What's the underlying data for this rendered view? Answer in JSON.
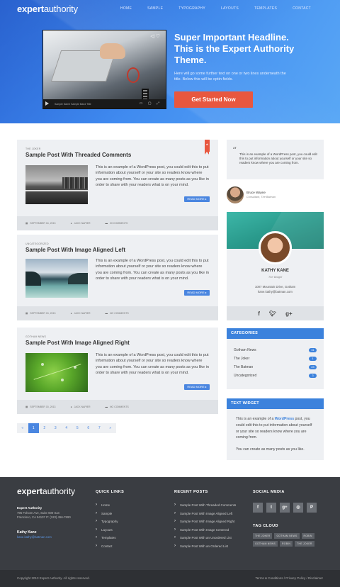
{
  "brand": {
    "bold": "expert",
    "light": "authority"
  },
  "nav": [
    "HOME",
    "SAMPLE",
    "TYPOGRAPHY",
    "LAYOUTS",
    "TEMPLATES",
    "CONTACT"
  ],
  "hero": {
    "headline": "Super Important Headline. This is the Expert Authority Theme.",
    "subtext": "Here will go some further text on one or two lines underneath the title. Below this will be optin fields.",
    "cta": "Get Started Now",
    "video_title": "Sample Name  Sample Band Title",
    "video_time": "0:00"
  },
  "posts": [
    {
      "category": "THE JOKER",
      "title": "Sample Post With Threaded Comments",
      "excerpt": "This is an example of a WordPress post, you could edit this to put information about yourself or your site so readers know where you are coming from. You can create as many posts as you like in order to share with your readers what is on your mind.",
      "read_more": "READ MORE ▸",
      "date": "SEPTEMBER 16, 2013",
      "author": "JACK NAPIER",
      "comments": "30 COMMENTS"
    },
    {
      "category": "UNCATEGORIZED",
      "title": "Sample Post With Image Aligned Left",
      "excerpt": "This is an example of a WordPress post, you could edit this to put information about yourself or your site so readers know where you are coming from. You can create as many posts as you like in order to share with your readers what is on your mind.",
      "read_more": "READ MORE ▸",
      "date": "SEPTEMBER 15, 2013",
      "author": "JACK NAPIER",
      "comments": "NO COMMENTS"
    },
    {
      "category": "GOTHAM NEWS",
      "title": "Sample Post With Image Aligned Right",
      "excerpt": "This is an example of a WordPress post, you could edit this to put information about yourself or your site so readers know where you are coming from. You can create as many posts as you like in order to share with your readers what is on your mind.",
      "read_more": "READ MORE ▸",
      "date": "SEPTEMBER 15, 2013",
      "author": "JACK NAPIER",
      "comments": "NO COMMENTS"
    }
  ],
  "pagination": [
    "«",
    "1",
    "2",
    "3",
    "4",
    "5",
    "6",
    "7",
    "»"
  ],
  "sidebar": {
    "quote": "This is an example of a WordPress post, you could edit this to put information about yourself or your site so readers know where you are coming from.",
    "quote_author": "Bruce Wayne",
    "quote_role": "Consultant, The Batman",
    "profile_name": "KATHY KANE",
    "profile_role": "The Batgirl",
    "profile_address": "1007 Mountain Drive, Gotham",
    "profile_email": "kane.kathy@batman.com",
    "categories_title": "CATEGORIES",
    "categories": [
      {
        "name": "Gotham News",
        "count": "31"
      },
      {
        "name": "The Joker",
        "count": "1"
      },
      {
        "name": "The Batman",
        "count": "23"
      },
      {
        "name": "Uncategorized",
        "count": "3"
      }
    ],
    "text_widget_title": "TEXT WIDGET",
    "text_widget_1a": "This is an example of a ",
    "text_widget_link": "WordPress",
    "text_widget_1b": " post, you could edit this to put information about yourself or your site so readers know where you are coming from.",
    "text_widget_2": "You can create as many posts as you like."
  },
  "footer": {
    "company": "Expert Authority",
    "address": "795 Folsom Ave, Suite 600 San Francisco, CA 94107 P: (123) 456-7890",
    "person": "Kathy Kane",
    "email": "kane.kathy@batman.com",
    "quick_links_title": "QUICK LINKS",
    "quick_links": [
      "Home",
      "Sample",
      "Typography",
      "Layouts",
      "Templates",
      "Contact"
    ],
    "recent_posts_title": "RECENT POSTS",
    "recent_posts": [
      "Sample Post With Threaded Comments",
      "Sample Post With Image Aligned Left",
      "Sample Post With Image Aligned Right",
      "Sample Post With Image Centered",
      "Sample Post With an Unordered List",
      "Sample Post With an Ordered List"
    ],
    "social_title": "SOCIAL MEDIA",
    "tag_cloud_title": "TAG CLOUD",
    "tags": [
      "THE JOKER",
      "GOTHAM NEWS",
      "ROBIN",
      "GOTHAM NEWS",
      "ROBIN",
      "THE JOKER"
    ],
    "copyright": "Copyright 2013 Expert Authority. All rights reserved.",
    "bottom_links": "Terms & Conditions / Privacy Policy / Disclaimer"
  },
  "colors": {
    "hero_blue": "#3f8af0",
    "cta": "#e8573f",
    "accent": "#3c82dc",
    "footer": "#3a3d42"
  }
}
